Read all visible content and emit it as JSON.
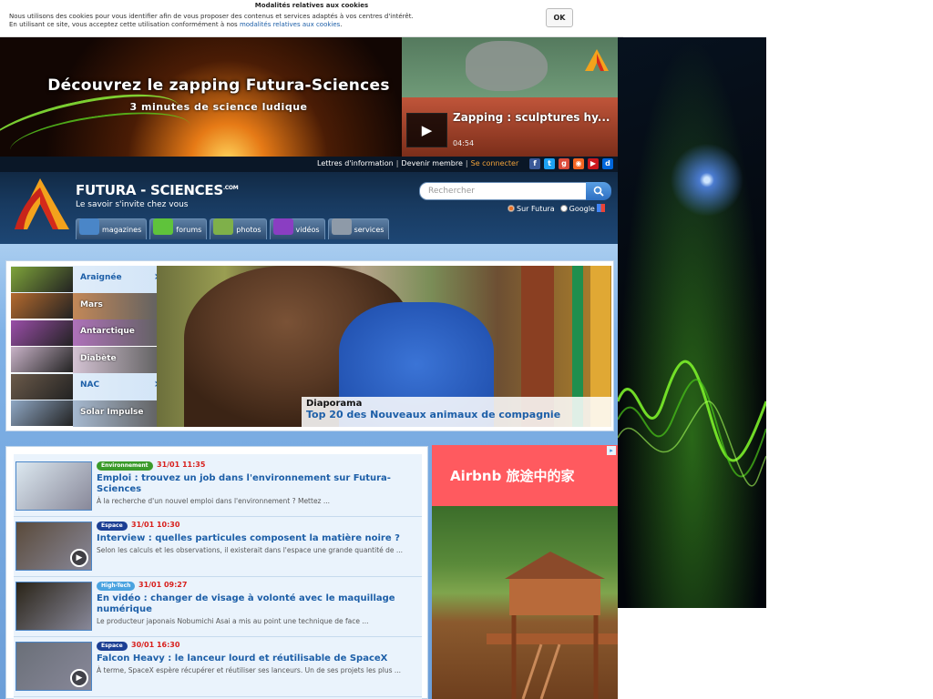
{
  "cookie": {
    "title": "Modalités relatives aux cookies",
    "line1": "Nous utilisons des cookies pour vous identifier afin de vous proposer des contenus et services adaptés à vos centres d'intérêt.",
    "line2_prefix": "En utilisant ce site, vous acceptez cette utilisation conformément à nos ",
    "line2_link": "modalités relatives aux cookies",
    "line2_suffix": ".",
    "ok_label": "OK"
  },
  "banner": {
    "title": "Découvrez le zapping Futura-Sciences",
    "subtitle": "3 minutes de science ludique"
  },
  "video": {
    "title": "Zapping : sculptures hy...",
    "duration": "04:54"
  },
  "topbar": {
    "newsletter": "Lettres d'information",
    "member": "Devenir membre",
    "login": "Se connecter",
    "sep": "|"
  },
  "social": [
    {
      "name": "facebook-icon",
      "glyph": "f",
      "color": "#3b5998"
    },
    {
      "name": "twitter-icon",
      "glyph": "t",
      "color": "#1da1f2"
    },
    {
      "name": "google-plus-icon",
      "glyph": "g",
      "color": "#dd4b39"
    },
    {
      "name": "rss-icon",
      "glyph": "◉",
      "color": "#f26522"
    },
    {
      "name": "youtube-icon",
      "glyph": "▶",
      "color": "#cc181e"
    },
    {
      "name": "dailymotion-icon",
      "glyph": "d",
      "color": "#0066dc"
    }
  ],
  "brand": {
    "name": "FUTURA - SCIENCES",
    "suffix": ".COM",
    "tagline": "Le savoir s'invite chez vous"
  },
  "search": {
    "placeholder": "Rechercher",
    "option_futura": "Sur Futura",
    "option_google": "Google"
  },
  "nav": [
    {
      "label": "magazines",
      "icon": "magazines-icon",
      "color": "#4a86c8"
    },
    {
      "label": "forums",
      "icon": "forums-icon",
      "color": "#5fc33b"
    },
    {
      "label": "photos",
      "icon": "photos-icon",
      "color": "#7fb04a"
    },
    {
      "label": "vidéos",
      "icon": "videos-icon",
      "color": "#8a3ec2"
    },
    {
      "label": "services",
      "icon": "services-icon",
      "color": "#8e9aa8"
    }
  ],
  "slider": {
    "thumbs": [
      {
        "label": "Araignée",
        "active": true,
        "color": "#7ea33a"
      },
      {
        "label": "Mars",
        "active": false,
        "color": "#b46a2e"
      },
      {
        "label": "Antarctique",
        "active": false,
        "color": "#9a4ea8"
      },
      {
        "label": "Diabète",
        "active": false,
        "color": "#c9b3c8"
      },
      {
        "label": "NAC",
        "active": true,
        "color": "#6b5a4a"
      },
      {
        "label": "Solar Impulse",
        "active": false,
        "color": "#8fa7c4"
      }
    ],
    "caption_kicker": "Diaporama",
    "caption_title": "Top 20 des Nouveaux animaux de compagnie"
  },
  "news": [
    {
      "badge": "Environnement",
      "badge_color": "#3a9a2a",
      "date": "31/01 11:35",
      "title": "Emploi : trouvez un job dans l'environnement sur Futura-Sciences",
      "desc": "À la recherche d'un nouvel emploi dans l'environnement ? Mettez ...",
      "video": false,
      "thumb": "#dce8f0"
    },
    {
      "badge": "Espace",
      "badge_color": "#1b3f94",
      "date": "31/01 10:30",
      "title": "Interview : quelles particules composent la matière noire ?",
      "desc": "Selon les calculs et les observations, il existerait dans l'espace une grande quantité de ...",
      "video": true,
      "thumb": "#5a4a3a"
    },
    {
      "badge": "High-Tech",
      "badge_color": "#4aa3e0",
      "date": "31/01 09:27",
      "title": "En vidéo : changer de visage à volonté avec le maquillage numérique",
      "desc": "Le producteur japonais Nobumichi Asai a mis au point une technique de face ...",
      "video": false,
      "thumb": "#2a2418"
    },
    {
      "badge": "Espace",
      "badge_color": "#1b3f94",
      "date": "30/01 16:30",
      "title": "Falcon Heavy : le lanceur lourd et réutilisable de SpaceX",
      "desc": "À terme, SpaceX espère récupérer et réutiliser ses lanceurs. Un de ses projets les plus ...",
      "video": true,
      "thumb": "#6a6f78"
    }
  ],
  "ad": {
    "headline": "Airbnb 旅途中的家",
    "brand_color": "#ff5a5f",
    "adchoice": "▸"
  }
}
